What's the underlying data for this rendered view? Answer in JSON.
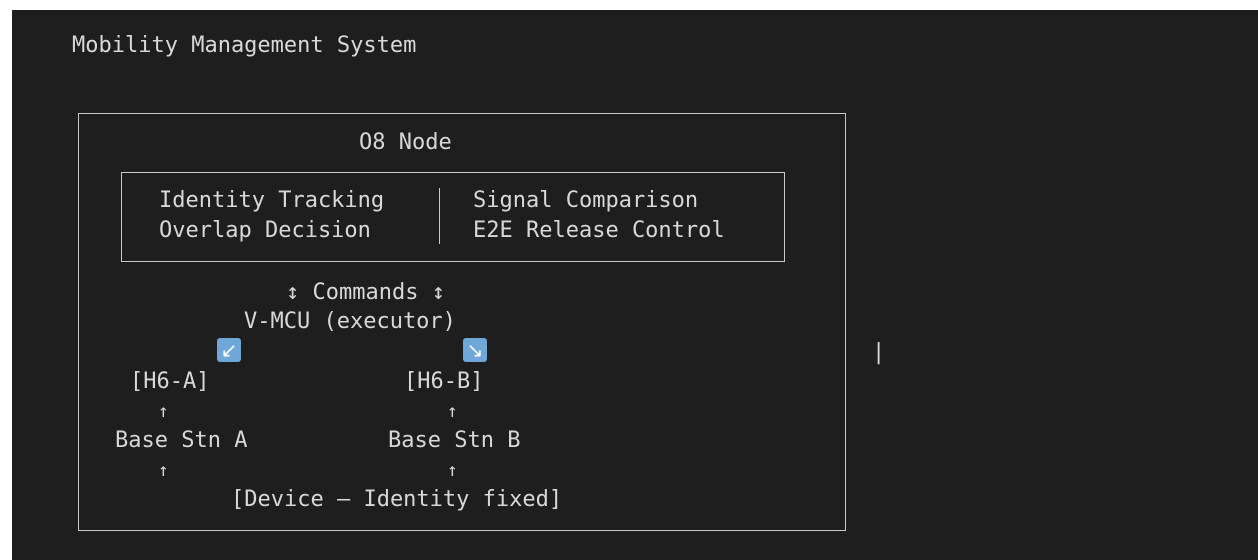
{
  "page_title": "Mobility Management System",
  "node": {
    "title": "O8 Node",
    "functions": {
      "left": [
        "Identity Tracking",
        "Overlap Decision"
      ],
      "right": [
        "Signal Comparison",
        "E2E Release Control"
      ]
    },
    "separator": "|"
  },
  "commands_label": "↕ Commands ↕",
  "vmcu_label": "V-MCU (executor)",
  "icons": {
    "left": "south-west-arrow",
    "right": "south-east-arrow",
    "left_glyph": "↙",
    "right_glyph": "↘"
  },
  "h6": {
    "a": "[H6-A]",
    "b": "[H6-B]"
  },
  "base": {
    "a": "Base Stn A",
    "b": "Base Stn B"
  },
  "up_arrow": "↑",
  "device_label": "[Device — Identity fixed]",
  "stray_bar": "|",
  "colors": {
    "background": "#1e1e1e",
    "text": "#d8d8d8",
    "border": "#c8c8c8",
    "icon": "#6fa8d8"
  }
}
